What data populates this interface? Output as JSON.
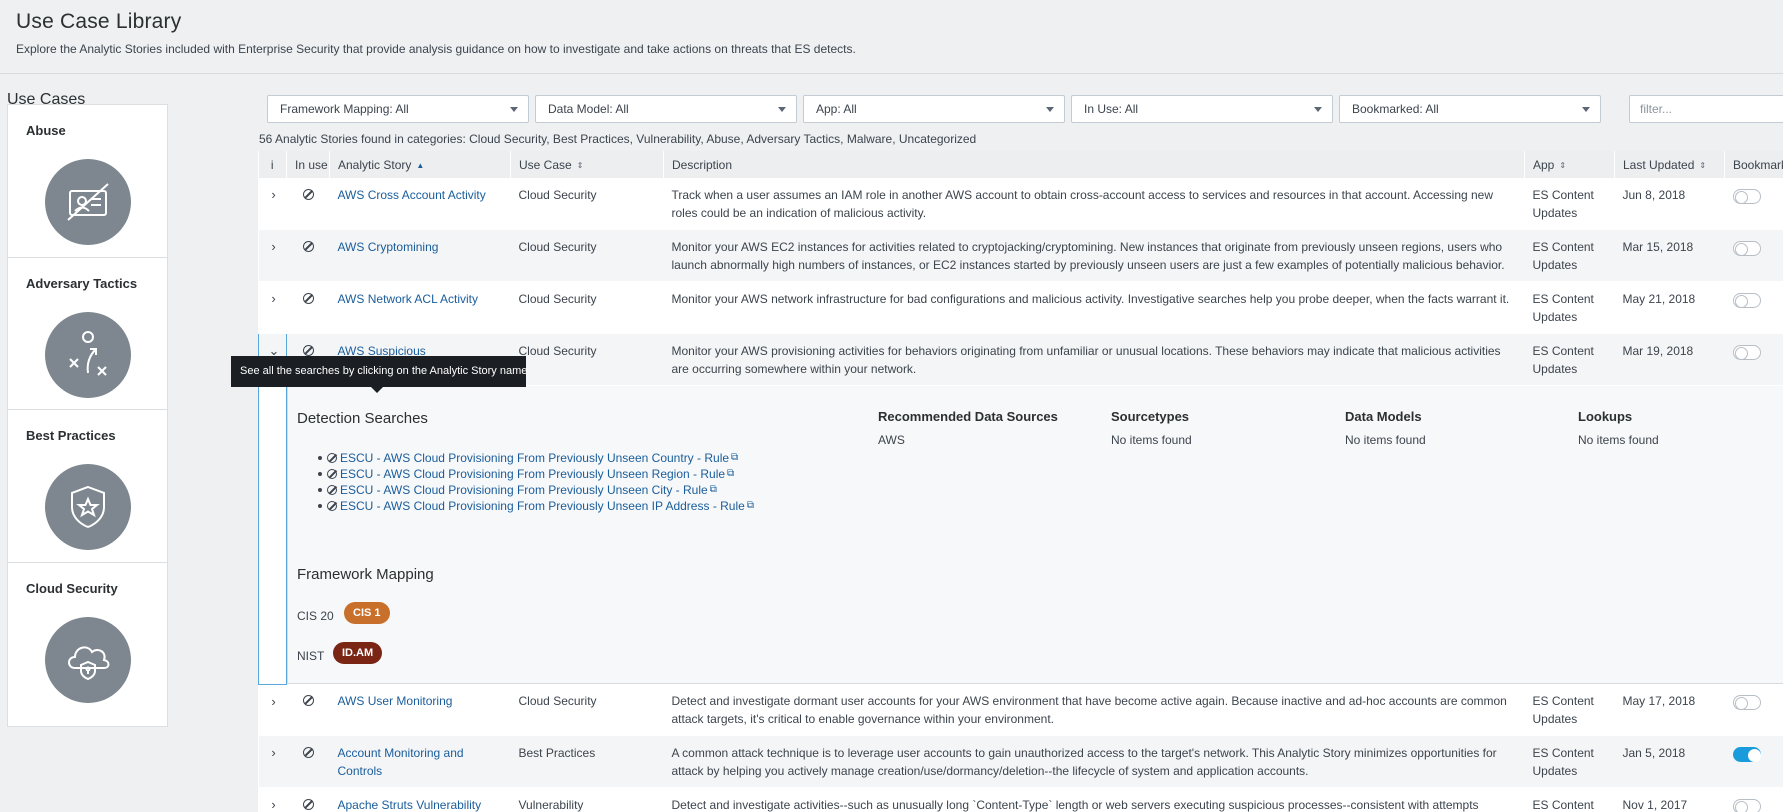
{
  "header": {
    "title": "Use Case Library",
    "description": "Explore the Analytic Stories included with Enterprise Security that provide analysis guidance on how to investigate and take actions on threats that ES detects."
  },
  "sidebar": {
    "title": "Use Cases",
    "cards": [
      {
        "label": "Abuse",
        "icon": "id-card-slash-icon"
      },
      {
        "label": "Adversary Tactics",
        "icon": "tactics-play-icon"
      },
      {
        "label": "Best Practices",
        "icon": "shield-star-icon"
      },
      {
        "label": "Cloud Security",
        "icon": "cloud-shield-icon"
      }
    ]
  },
  "filters": {
    "framework": "Framework Mapping: All",
    "data_model": "Data Model: All",
    "app": "App: All",
    "in_use": "In Use: All",
    "bookmarked": "Bookmarked: All",
    "search_placeholder": "filter..."
  },
  "summary": "56 Analytic Stories found in categories: Cloud Security, Best Practices, Vulnerability, Abuse, Adversary Tactics, Malware, Uncategorized",
  "columns": {
    "info": "i",
    "in_use": "In use",
    "story": "Analytic Story",
    "use_case": "Use Case",
    "description": "Description",
    "app": "App",
    "last_updated": "Last Updated",
    "bookmarked": "Bookmarked"
  },
  "rows": [
    {
      "story": "AWS Cross Account Activity",
      "use_case": "Cloud Security",
      "description": "Track when a user assumes an IAM role in another AWS account to obtain cross-account access to services and resources in that account. Accessing new roles could be an indication of malicious activity.",
      "app": "ES Content Updates",
      "updated": "Jun 8, 2018",
      "bookmarked": false
    },
    {
      "story": "AWS Cryptomining",
      "use_case": "Cloud Security",
      "description": "Monitor your AWS EC2 instances for activities related to cryptojacking/cryptomining. New instances that originate from previously unseen regions, users who launch abnormally high numbers of instances, or EC2 instances started by previously unseen users are just a few examples of potentially malicious behavior.",
      "app": "ES Content Updates",
      "updated": "Mar 15, 2018",
      "bookmarked": false
    },
    {
      "story": "AWS Network ACL Activity",
      "use_case": "Cloud Security",
      "description": "Monitor your AWS network infrastructure for bad configurations and malicious activity. Investigative searches help you probe deeper, when the facts warrant it.",
      "app": "ES Content Updates",
      "updated": "May 21, 2018",
      "bookmarked": false
    },
    {
      "story": "AWS Suspicious",
      "use_case": "Cloud Security",
      "description": "Monitor your AWS provisioning activities for behaviors originating from unfamiliar or unusual locations. These behaviors may indicate that malicious activities are occurring somewhere within your network.",
      "app": "ES Content Updates",
      "updated": "Mar 19, 2018",
      "bookmarked": false
    },
    {
      "story": "AWS User Monitoring",
      "use_case": "Cloud Security",
      "description": "Detect and investigate dormant user accounts for your AWS environment that have become active again. Because inactive and ad-hoc accounts are common attack targets, it's critical to enable governance within your environment.",
      "app": "ES Content Updates",
      "updated": "May 17, 2018",
      "bookmarked": false
    },
    {
      "story": "Account Monitoring and Controls",
      "use_case": "Best Practices",
      "description": "A common attack technique is to leverage user accounts to gain unauthorized access to the target's network. This Analytic Story minimizes opportunities for attack by helping you actively manage creation/use/dormancy/deletion--the lifecycle of system and application accounts.",
      "app": "ES Content Updates",
      "updated": "Jan 5, 2018",
      "bookmarked": true
    },
    {
      "story": "Apache Struts Vulnerability",
      "use_case": "Vulnerability",
      "description": "Detect and investigate activities--such as unusually long `Content-Type` length or web servers executing suspicious processes--consistent with attempts",
      "app": "ES Content",
      "updated": "Nov 1, 2017",
      "bookmarked": false
    }
  ],
  "tooltip": "See all the searches by clicking on the Analytic Story name",
  "detail": {
    "detection_title": "Detection Searches",
    "searches": [
      "ESCU - AWS Cloud Provisioning From Previously Unseen Country - Rule",
      "ESCU - AWS Cloud Provisioning From Previously Unseen Region - Rule",
      "ESCU - AWS Cloud Provisioning From Previously Unseen City - Rule",
      "ESCU - AWS Cloud Provisioning From Previously Unseen IP Address - Rule"
    ],
    "rec_sources_title": "Recommended Data Sources",
    "rec_sources_value": "AWS",
    "sourcetypes_title": "Sourcetypes",
    "sourcetypes_value": "No items found",
    "data_models_title": "Data Models",
    "data_models_value": "No items found",
    "lookups_title": "Lookups",
    "lookups_value": "No items found",
    "framework_title": "Framework Mapping",
    "cis_label": "CIS 20",
    "cis_badge": "CIS 1",
    "nist_label": "NIST",
    "nist_badge": "ID.AM"
  },
  "colors": {
    "cis_badge": "#c8702b",
    "nist_badge": "#7b2515",
    "link": "#1a5d9c",
    "toggle_on": "#1a9cdc"
  }
}
